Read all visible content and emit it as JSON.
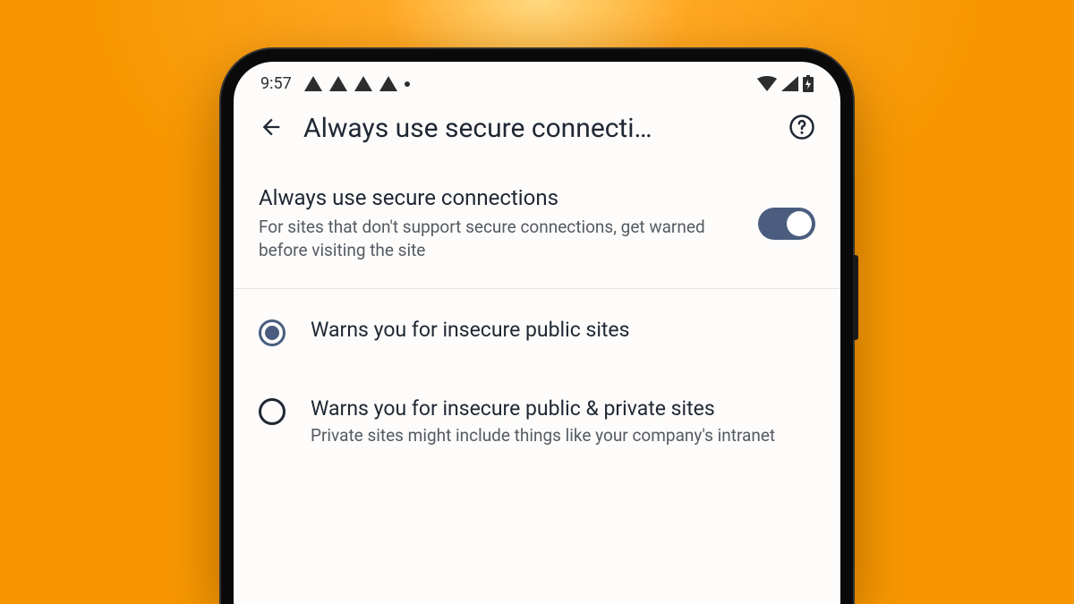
{
  "statusBar": {
    "time": "9:57"
  },
  "appBar": {
    "title": "Always use secure connecti…"
  },
  "mainToggle": {
    "title": "Always use secure connections",
    "description": "For sites that don't support secure connections, get warned before visiting the site",
    "enabled": true
  },
  "options": [
    {
      "title": "Warns you for insecure public sites",
      "description": "",
      "selected": true
    },
    {
      "title": "Warns you for insecure public & private sites",
      "description": "Private sites might include things like your company's intranet",
      "selected": false
    }
  ]
}
